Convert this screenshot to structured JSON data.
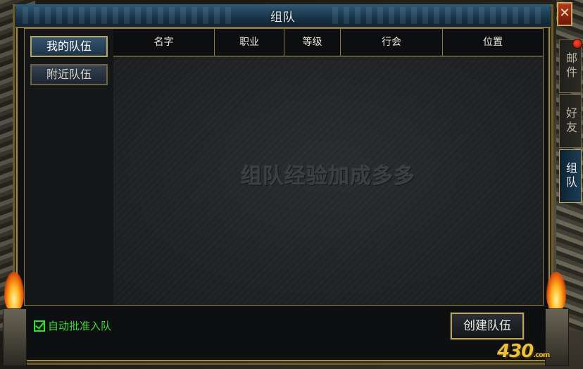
{
  "window": {
    "title": "组队",
    "close_glyph": "✕"
  },
  "side_tabs": [
    {
      "label": "邮件",
      "has_notification": true
    },
    {
      "label": "好友",
      "has_notification": false
    },
    {
      "label": "组队",
      "has_notification": false,
      "active": true
    }
  ],
  "nav": {
    "my_team": "我的队伍",
    "nearby_teams": "附近队伍"
  },
  "table": {
    "columns": [
      "名字",
      "职业",
      "等级",
      "行会",
      "位置"
    ]
  },
  "watermark": "组队经验加成多多",
  "footer": {
    "auto_approve_label": "自动批准入队",
    "auto_approve_checked": true,
    "create_team_label": "创建队伍"
  },
  "branding": {
    "logo_text": "430",
    "logo_suffix": ".com"
  },
  "colors": {
    "accent_green": "#3cd936",
    "frame_gold": "#a08a45",
    "title_blue": "#183448"
  }
}
